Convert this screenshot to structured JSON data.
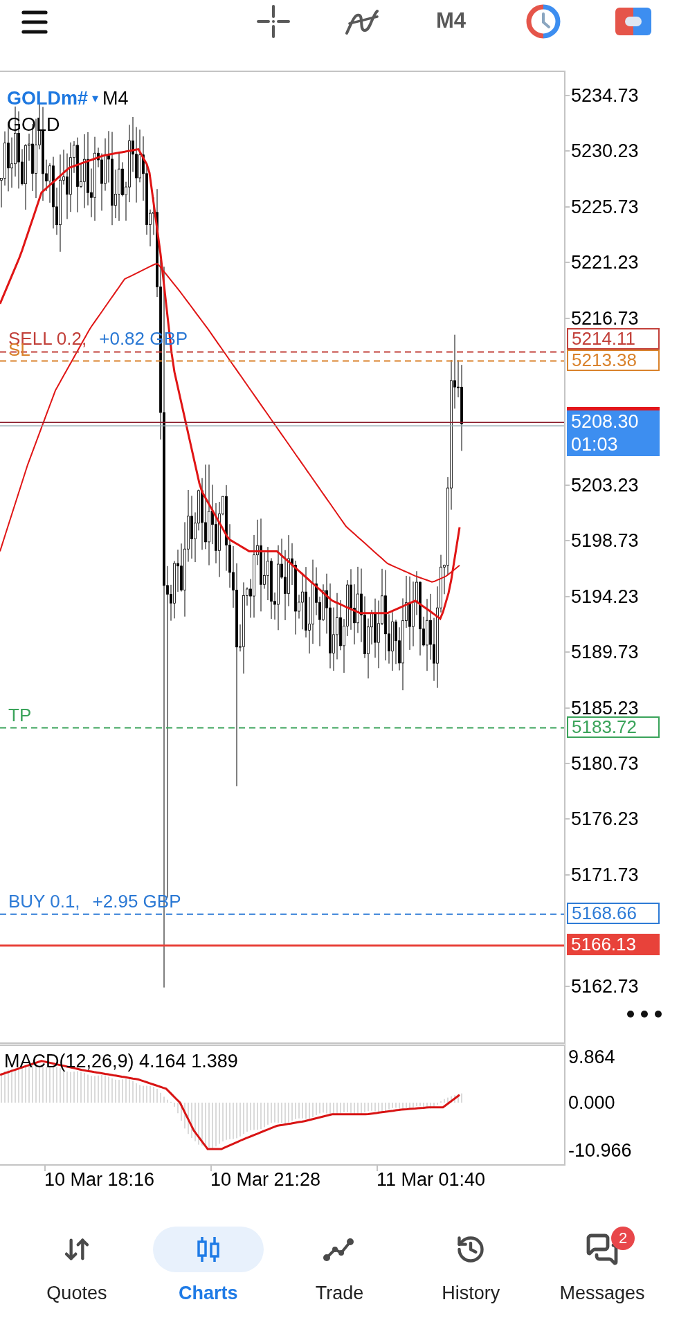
{
  "toolbar": {
    "timeframe": "M4"
  },
  "chart": {
    "symbol": "GOLDm#",
    "dropdown_glyph": "▾",
    "timeframe": "M4",
    "description": "GOLD",
    "price_ticks": [
      "5234.73",
      "5230.23",
      "5225.73",
      "5221.23",
      "5216.73",
      "5203.23",
      "5198.73",
      "5194.23",
      "5189.73",
      "5185.23",
      "5180.73",
      "5176.23",
      "5171.73",
      "5162.73"
    ],
    "trade_lines": [
      {
        "kind": "order",
        "label": "SELL 0.2,",
        "profit": "+0.82 GBP",
        "tag": "5214.11",
        "color": "#c2403a"
      },
      {
        "kind": "stop",
        "label": "SL",
        "tag": "5213.38",
        "color": "#d9822b"
      },
      {
        "kind": "bid",
        "tag": "5208.30",
        "countdown": "01:03",
        "color": "#3d8ef0"
      },
      {
        "kind": "take",
        "label": "TP",
        "tag": "5183.72",
        "color": "#3aa35a"
      },
      {
        "kind": "order",
        "label": "BUY 0.1,",
        "profit": "+2.95 GBP",
        "tag": "5168.66",
        "color": "#2e7bd6"
      },
      {
        "kind": "level",
        "tag": "5166.13",
        "color": "#e8423a"
      }
    ]
  },
  "macd": {
    "label": "MACD(12,26,9) 4.164 1.389",
    "ticks": [
      "9.864",
      "0.000",
      "-10.966"
    ]
  },
  "time_axis": [
    "10 Mar 18:16",
    "10 Mar 21:28",
    "11 Mar 01:40"
  ],
  "nav": [
    {
      "kind": "quotes",
      "label": "Quotes",
      "selected": false
    },
    {
      "kind": "charts",
      "label": "Charts",
      "selected": true
    },
    {
      "kind": "trade",
      "label": "Trade",
      "selected": false
    },
    {
      "kind": "history",
      "label": "History",
      "selected": false
    },
    {
      "kind": "messages",
      "label": "Messages",
      "selected": false,
      "badge": "2"
    }
  ]
}
